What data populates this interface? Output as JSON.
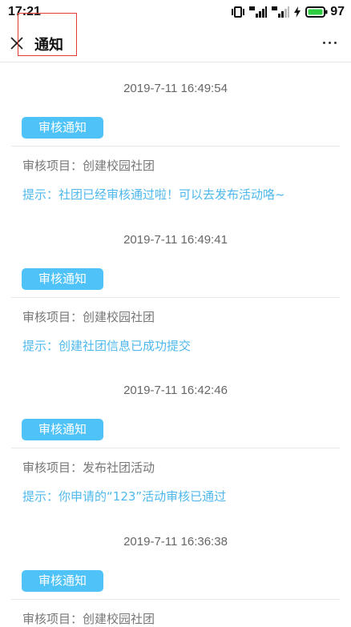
{
  "status_bar": {
    "time": "17:21",
    "battery": "97",
    "icons": [
      "vibrate-icon",
      "signal-4g-icon",
      "signal-4g-icon",
      "charging-icon",
      "battery-icon"
    ]
  },
  "nav": {
    "title": "通知",
    "close_icon": "close-icon",
    "more_icon": "more-icon"
  },
  "notices": [
    {
      "time": "2019-7-11 16:49:54",
      "badge": "审核通知",
      "project": "审核项目：创建校园社团",
      "tip": "提示：社团已经审核通过啦！可以去发布活动咯~"
    },
    {
      "time": "2019-7-11 16:49:41",
      "badge": "审核通知",
      "project": "审核项目：创建校园社团",
      "tip": "提示：创建社团信息已成功提交"
    },
    {
      "time": "2019-7-11 16:42:46",
      "badge": "审核通知",
      "project": "审核项目：发布社团活动",
      "tip": "提示：你申请的“123”活动审核已通过"
    },
    {
      "time": "2019-7-11 16:36:38",
      "badge": "审核通知",
      "project": "审核项目：创建校园社团",
      "tip": ""
    }
  ],
  "colors": {
    "accent": "#4fc3f7",
    "tip_text": "#4fb8ec",
    "highlight_box": "#e53935"
  }
}
